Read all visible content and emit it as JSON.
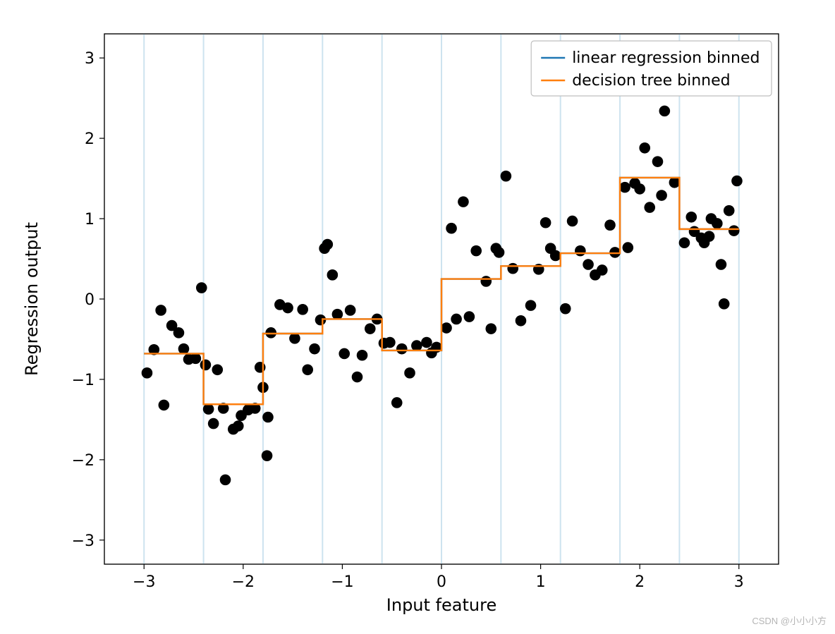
{
  "chart_data": {
    "type": "scatter",
    "xlabel": "Input feature",
    "ylabel": "Regression output",
    "xlim": [
      -3.4,
      3.4
    ],
    "ylim": [
      -3.3,
      3.3
    ],
    "xticks": [
      -3,
      -2,
      -1,
      0,
      1,
      2,
      3
    ],
    "yticks": [
      -3,
      -2,
      -1,
      0,
      1,
      2,
      3
    ],
    "bin_edges": [
      -3.0,
      -2.4,
      -1.8,
      -1.2,
      -0.6,
      0.0,
      0.6,
      1.2,
      1.8,
      2.4,
      3.0
    ],
    "legend": {
      "entries": [
        {
          "label": "linear regression binned",
          "color": "#1f77b4"
        },
        {
          "label": "decision tree binned",
          "color": "#ff7f0e"
        }
      ],
      "position": "upper right"
    },
    "series": [
      {
        "name": "linear regression binned",
        "type": "step",
        "color": "#1f77b4",
        "x_edges": [
          -3.0,
          -2.4,
          -1.8,
          -1.2,
          -0.6,
          0.0,
          0.6,
          1.2,
          1.8,
          2.4,
          3.0
        ],
        "y_per_bin": [
          -0.68,
          -1.31,
          -0.43,
          -0.25,
          -0.64,
          0.25,
          0.41,
          0.57,
          1.51,
          0.87
        ]
      },
      {
        "name": "decision tree binned",
        "type": "step",
        "color": "#ff7f0e",
        "x_edges": [
          -3.0,
          -2.4,
          -1.8,
          -1.2,
          -0.6,
          0.0,
          0.6,
          1.2,
          1.8,
          2.4,
          3.0
        ],
        "y_per_bin": [
          -0.68,
          -1.31,
          -0.43,
          -0.25,
          -0.64,
          0.25,
          0.41,
          0.57,
          1.51,
          0.87
        ]
      },
      {
        "name": "data points",
        "type": "scatter",
        "color": "#000000",
        "points": [
          [
            -2.97,
            -0.92
          ],
          [
            -2.9,
            -0.63
          ],
          [
            -2.83,
            -0.14
          ],
          [
            -2.8,
            -1.32
          ],
          [
            -2.72,
            -0.33
          ],
          [
            -2.65,
            -0.42
          ],
          [
            -2.6,
            -0.62
          ],
          [
            -2.55,
            -0.75
          ],
          [
            -2.48,
            -0.74
          ],
          [
            -2.42,
            0.14
          ],
          [
            -2.38,
            -0.82
          ],
          [
            -2.35,
            -1.37
          ],
          [
            -2.3,
            -1.55
          ],
          [
            -2.26,
            -0.88
          ],
          [
            -2.2,
            -1.36
          ],
          [
            -2.18,
            -2.25
          ],
          [
            -2.1,
            -1.62
          ],
          [
            -2.05,
            -1.58
          ],
          [
            -2.02,
            -1.45
          ],
          [
            -1.95,
            -1.38
          ],
          [
            -1.88,
            -1.36
          ],
          [
            -1.83,
            -0.85
          ],
          [
            -1.8,
            -1.1
          ],
          [
            -1.76,
            -1.95
          ],
          [
            -1.75,
            -1.47
          ],
          [
            -1.72,
            -0.42
          ],
          [
            -1.63,
            -0.07
          ],
          [
            -1.55,
            -0.11
          ],
          [
            -1.48,
            -0.49
          ],
          [
            -1.4,
            -0.13
          ],
          [
            -1.35,
            -0.88
          ],
          [
            -1.28,
            -0.62
          ],
          [
            -1.22,
            -0.26
          ],
          [
            -1.18,
            0.63
          ],
          [
            -1.15,
            0.68
          ],
          [
            -1.1,
            0.3
          ],
          [
            -1.05,
            -0.19
          ],
          [
            -0.98,
            -0.68
          ],
          [
            -0.92,
            -0.14
          ],
          [
            -0.85,
            -0.97
          ],
          [
            -0.8,
            -0.7
          ],
          [
            -0.72,
            -0.37
          ],
          [
            -0.65,
            -0.25
          ],
          [
            -0.58,
            -0.55
          ],
          [
            -0.52,
            -0.54
          ],
          [
            -0.45,
            -1.29
          ],
          [
            -0.4,
            -0.62
          ],
          [
            -0.32,
            -0.92
          ],
          [
            -0.25,
            -0.58
          ],
          [
            -0.15,
            -0.54
          ],
          [
            -0.1,
            -0.67
          ],
          [
            -0.05,
            -0.6
          ],
          [
            0.05,
            -0.36
          ],
          [
            0.1,
            0.88
          ],
          [
            0.15,
            -0.25
          ],
          [
            0.22,
            1.21
          ],
          [
            0.28,
            -0.22
          ],
          [
            0.35,
            0.6
          ],
          [
            0.45,
            0.22
          ],
          [
            0.5,
            -0.37
          ],
          [
            0.55,
            0.63
          ],
          [
            0.58,
            0.58
          ],
          [
            0.65,
            1.53
          ],
          [
            0.72,
            0.38
          ],
          [
            0.8,
            -0.27
          ],
          [
            0.9,
            -0.08
          ],
          [
            0.98,
            0.37
          ],
          [
            1.05,
            0.95
          ],
          [
            1.1,
            0.63
          ],
          [
            1.15,
            0.54
          ],
          [
            1.25,
            -0.12
          ],
          [
            1.32,
            0.97
          ],
          [
            1.4,
            0.6
          ],
          [
            1.48,
            0.43
          ],
          [
            1.55,
            0.3
          ],
          [
            1.62,
            0.36
          ],
          [
            1.7,
            0.92
          ],
          [
            1.75,
            0.58
          ],
          [
            1.85,
            1.39
          ],
          [
            1.88,
            0.64
          ],
          [
            1.95,
            1.44
          ],
          [
            2.0,
            1.37
          ],
          [
            2.05,
            1.88
          ],
          [
            2.1,
            1.14
          ],
          [
            2.18,
            1.71
          ],
          [
            2.22,
            1.29
          ],
          [
            2.25,
            2.34
          ],
          [
            2.35,
            1.45
          ],
          [
            2.45,
            0.7
          ],
          [
            2.52,
            1.02
          ],
          [
            2.55,
            0.84
          ],
          [
            2.62,
            0.76
          ],
          [
            2.65,
            0.7
          ],
          [
            2.7,
            0.78
          ],
          [
            2.72,
            1.0
          ],
          [
            2.78,
            0.94
          ],
          [
            2.82,
            0.43
          ],
          [
            2.85,
            -0.06
          ],
          [
            2.9,
            1.1
          ],
          [
            2.95,
            0.85
          ],
          [
            2.98,
            1.47
          ]
        ]
      }
    ]
  },
  "watermark": "CSDN @小小小方"
}
